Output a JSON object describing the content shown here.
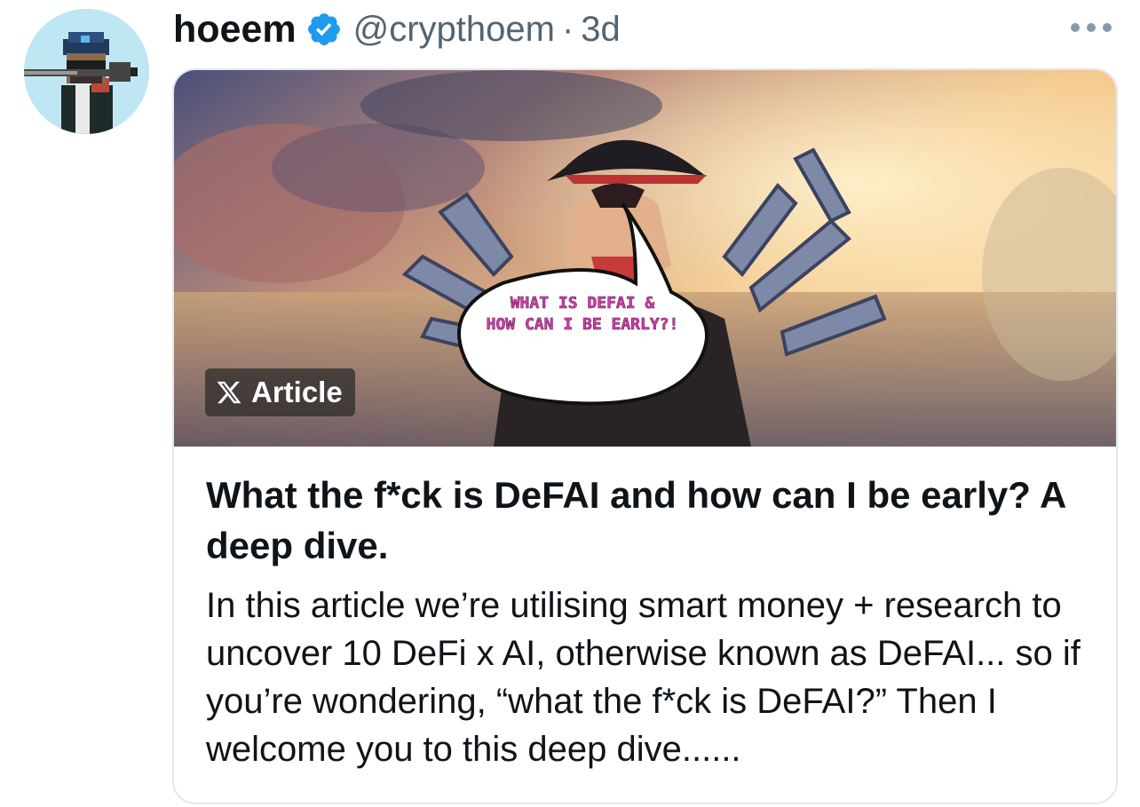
{
  "tweet": {
    "author_name": "hoeem",
    "author_handle": "@crypthoem",
    "separator": "·",
    "timestamp": "3d",
    "icons": {
      "avatar": "avatar-image",
      "verified": "verified-badge-icon",
      "more": "more-options-icon",
      "x_logo": "x-logo-icon"
    }
  },
  "article_card": {
    "badge_label": "Article",
    "image_caption_line1": "WHAT IS DEFAI &",
    "image_caption_line2": "HOW CAN I BE EARLY?!",
    "title": "What the f*ck is DeFAI and how can I be early? A deep dive.",
    "description": "In this article we’re utilising smart money + research to uncover 10 DeFi x AI, otherwise known as DeFAI... so if you’re wondering, “what the f*ck is DeFAI?” Then I welcome you to this deep dive......"
  },
  "colors": {
    "text_primary": "#0f1419",
    "text_secondary": "#536471",
    "verified_blue": "#1d9bf0",
    "border": "#e1e8ed",
    "caption_pink": "#d63bb0"
  }
}
